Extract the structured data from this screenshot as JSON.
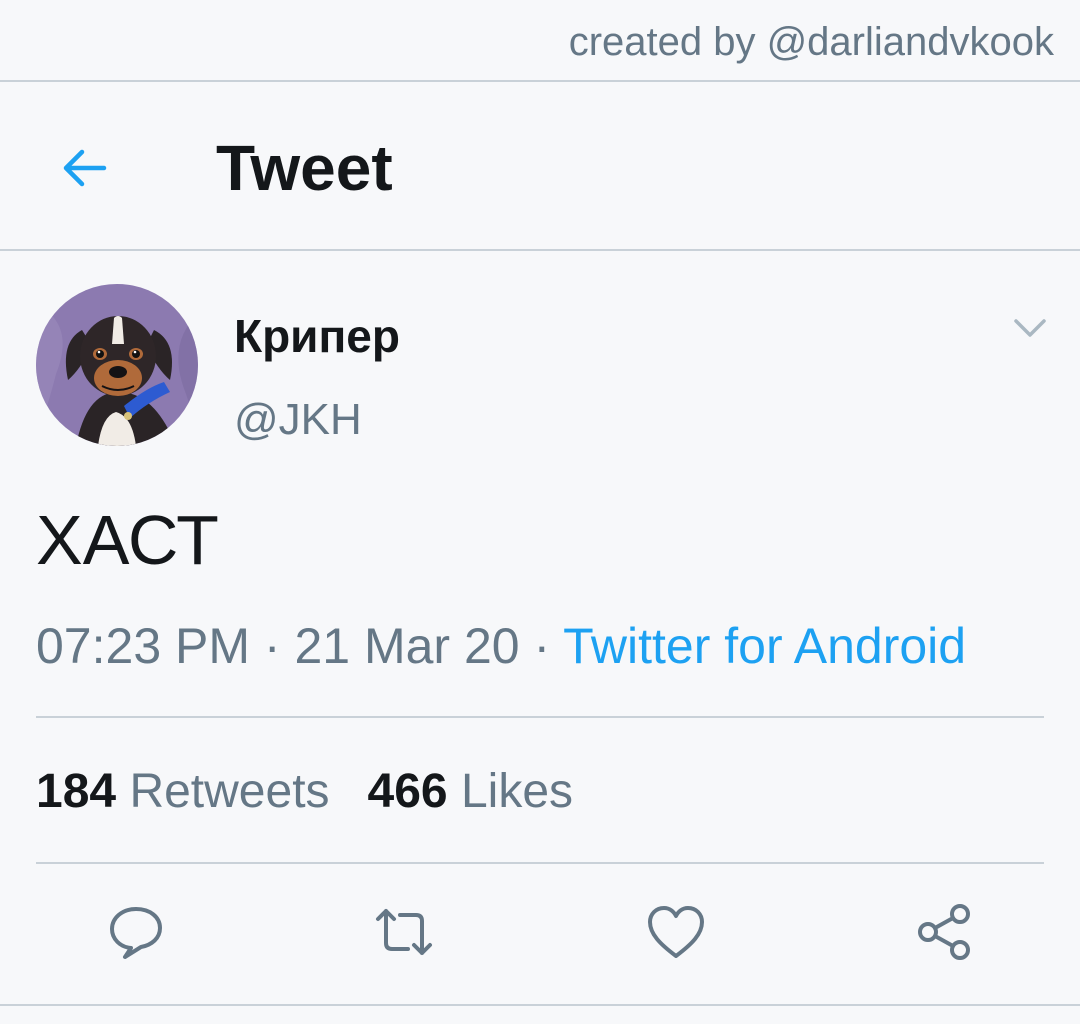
{
  "watermark": "created by @darliandvkook",
  "header": {
    "title": "Tweet",
    "back_icon": "arrow-left-icon"
  },
  "tweet": {
    "display_name": "Крипер",
    "handle": "@JKH",
    "text": "ХАСТ",
    "time": "07:23 PM",
    "date": "21 Mar 20",
    "separator": " · ",
    "source": "Twitter for Android",
    "retweets_count": "184",
    "retweets_label": "Retweets",
    "likes_count": "466",
    "likes_label": "Likes"
  },
  "actions": [
    "reply-icon",
    "retweet-icon",
    "like-icon",
    "share-icon"
  ],
  "colors": {
    "accent": "#1da1f2",
    "muted": "#657786",
    "text": "#14171a",
    "divider": "#c9d1d8",
    "background": "#f7f8fa"
  }
}
